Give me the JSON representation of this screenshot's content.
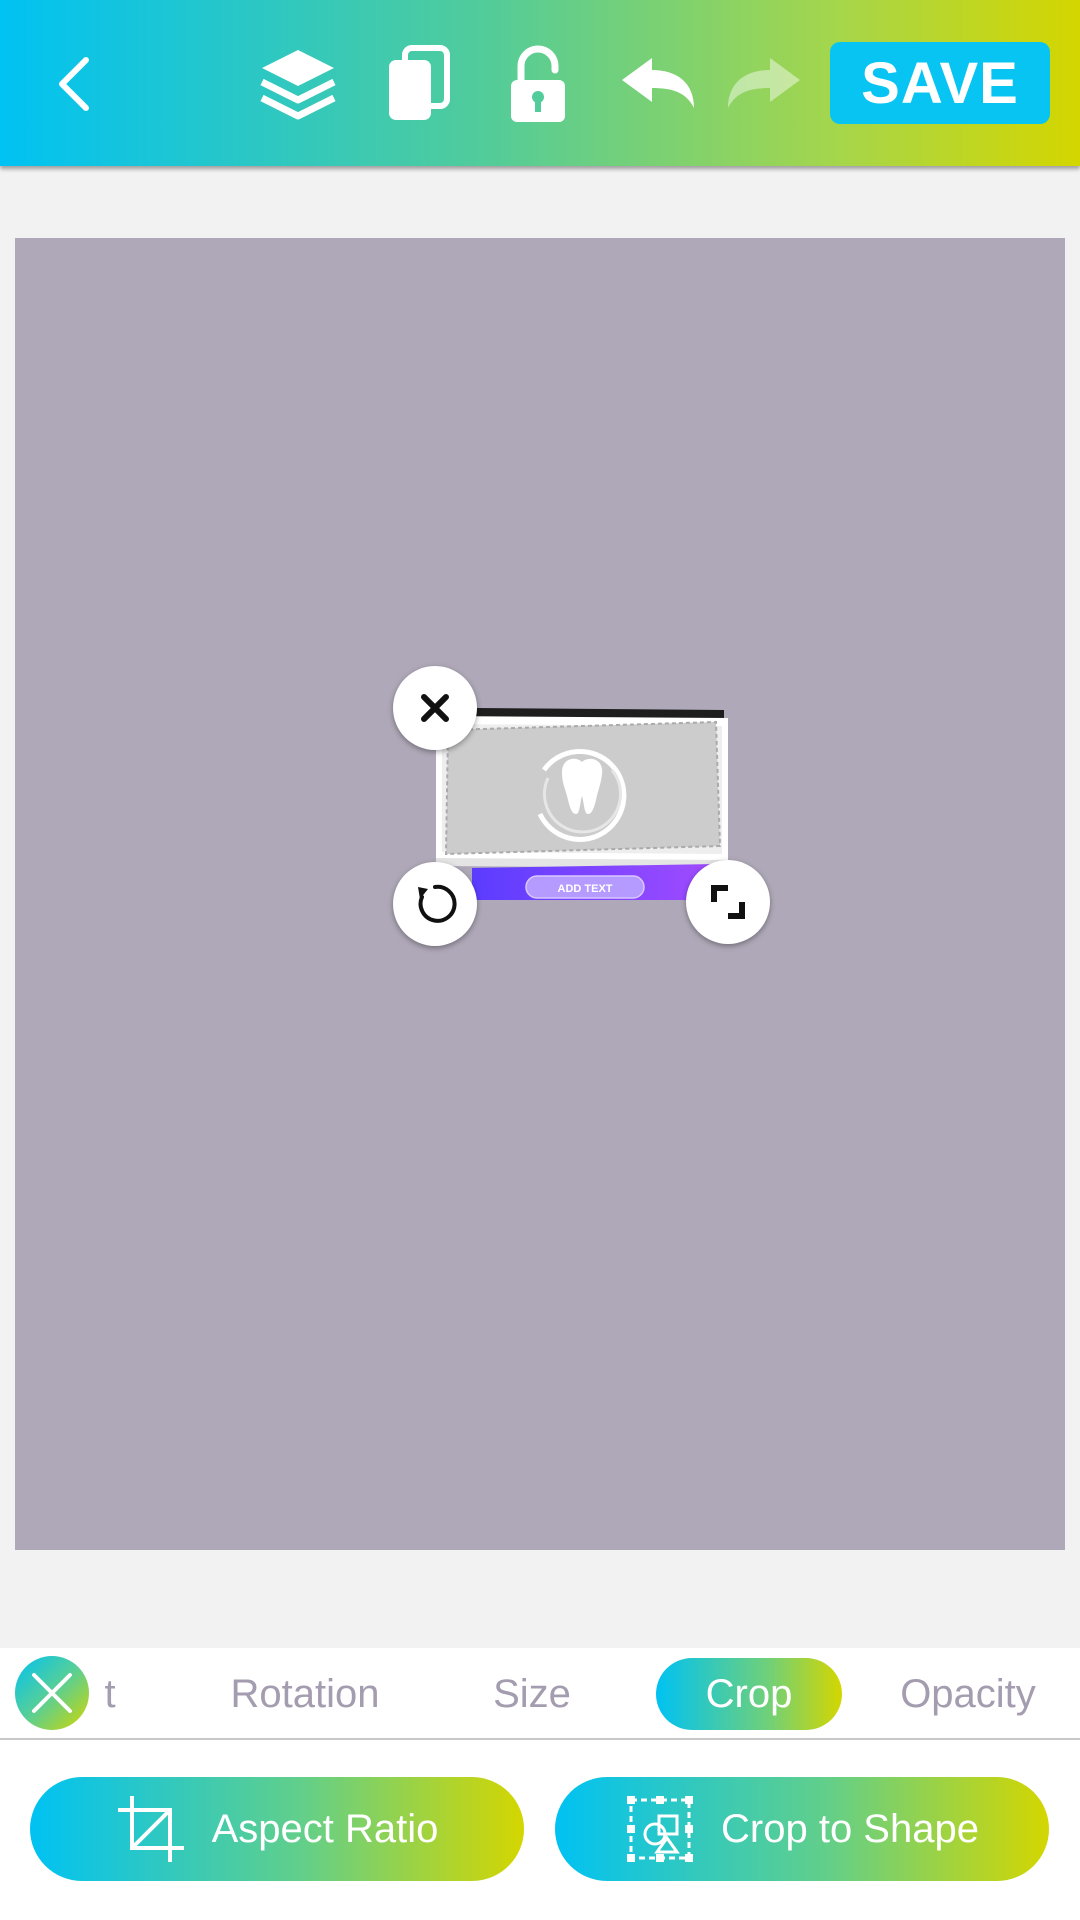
{
  "toolbar": {
    "back_icon": "chevron-left-icon",
    "layers_icon": "layers-icon",
    "duplicate_icon": "duplicate-icon",
    "lock_icon": "unlocked-padlock-icon",
    "undo_icon": "undo-icon",
    "redo_icon": "redo-icon",
    "save_label": "SAVE",
    "redo_enabled": false
  },
  "canvas": {
    "background_color": "#afa8b8",
    "selected_item": {
      "button_text": "ADD TEXT",
      "logo_icon": "tooth-icon",
      "handles": {
        "delete": "close-icon",
        "rotate": "rotate-icon",
        "resize": "resize-icon"
      }
    }
  },
  "tabs": {
    "close_icon": "close-icon",
    "items": [
      {
        "label": "t",
        "active": false
      },
      {
        "label": "Rotation",
        "active": false
      },
      {
        "label": "Size",
        "active": false
      },
      {
        "label": "Crop",
        "active": true
      },
      {
        "label": "Opacity",
        "active": false
      }
    ]
  },
  "actions": {
    "aspect_ratio": {
      "label": "Aspect Ratio",
      "icon": "crop-icon"
    },
    "crop_to_shape": {
      "label": "Crop to Shape",
      "icon": "shape-crop-icon"
    }
  },
  "colors": {
    "gradient_start": "#00c2f3",
    "gradient_end": "#d4d600",
    "save_button": "#08c4f2",
    "inactive_tab_text": "#a49caf"
  }
}
